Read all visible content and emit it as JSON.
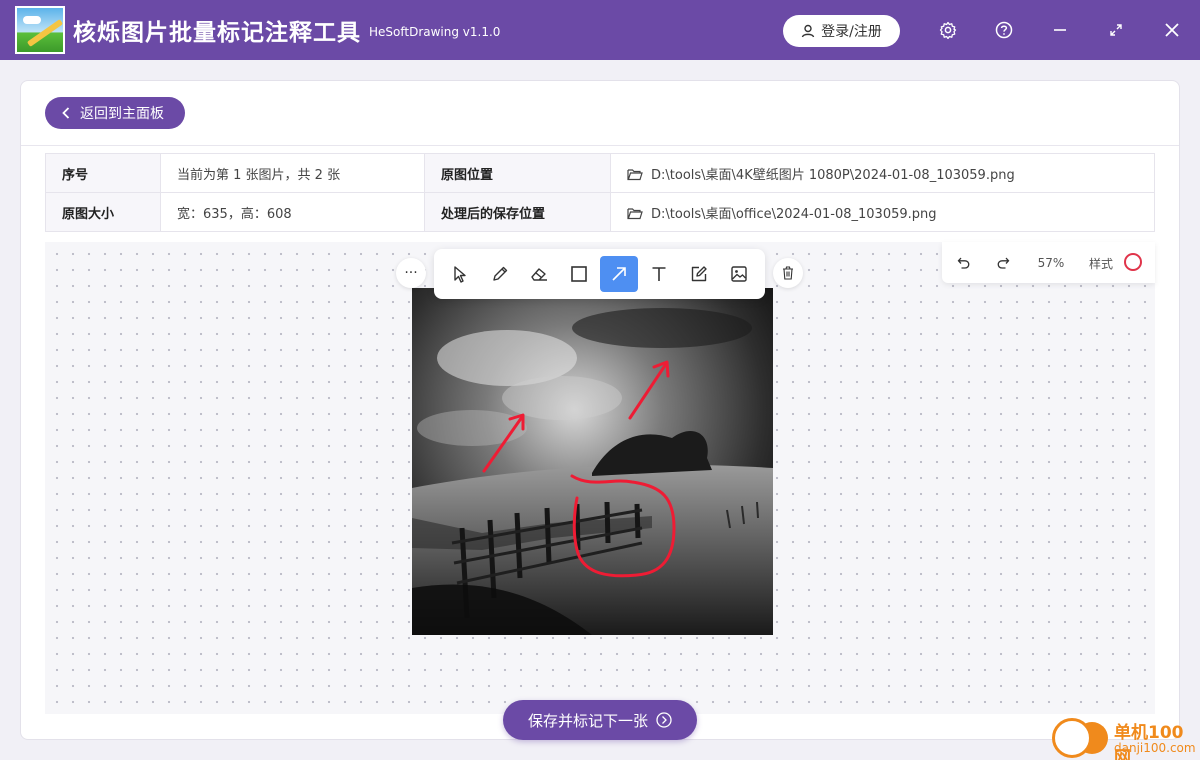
{
  "app": {
    "title": "核烁图片批量标记注释工具",
    "version": "HeSoftDrawing v1.1.0",
    "login_label": "登录/注册",
    "accent_color": "#6b4aa6"
  },
  "nav": {
    "back_label": "返回到主面板"
  },
  "info": {
    "index_label": "序号",
    "index_value": "当前为第 1 张图片，共 2 张",
    "source_label": "原图位置",
    "source_value": "D:\\tools\\桌面\\4K壁纸图片 1080P\\2024-01-08_103059.png",
    "size_label": "原图大小",
    "size_value": "宽：635，高：608",
    "save_label": "处理后的保存位置",
    "save_value": "D:\\tools\\桌面\\office\\2024-01-08_103059.png"
  },
  "toolbar": {
    "tools": [
      "select-icon",
      "pencil-icon",
      "eraser-icon",
      "rectangle-icon",
      "arrow-icon",
      "text-icon",
      "edit-icon",
      "image-icon"
    ],
    "active_tool": "arrow-icon",
    "active_color": "#4e8ff2"
  },
  "view": {
    "zoom": "57%",
    "style_label": "样式",
    "stroke_color": "#e0344a"
  },
  "actions": {
    "save_next_label": "保存并标记下一张"
  },
  "watermark": {
    "name": "单机100网",
    "url": "danji100.com"
  }
}
